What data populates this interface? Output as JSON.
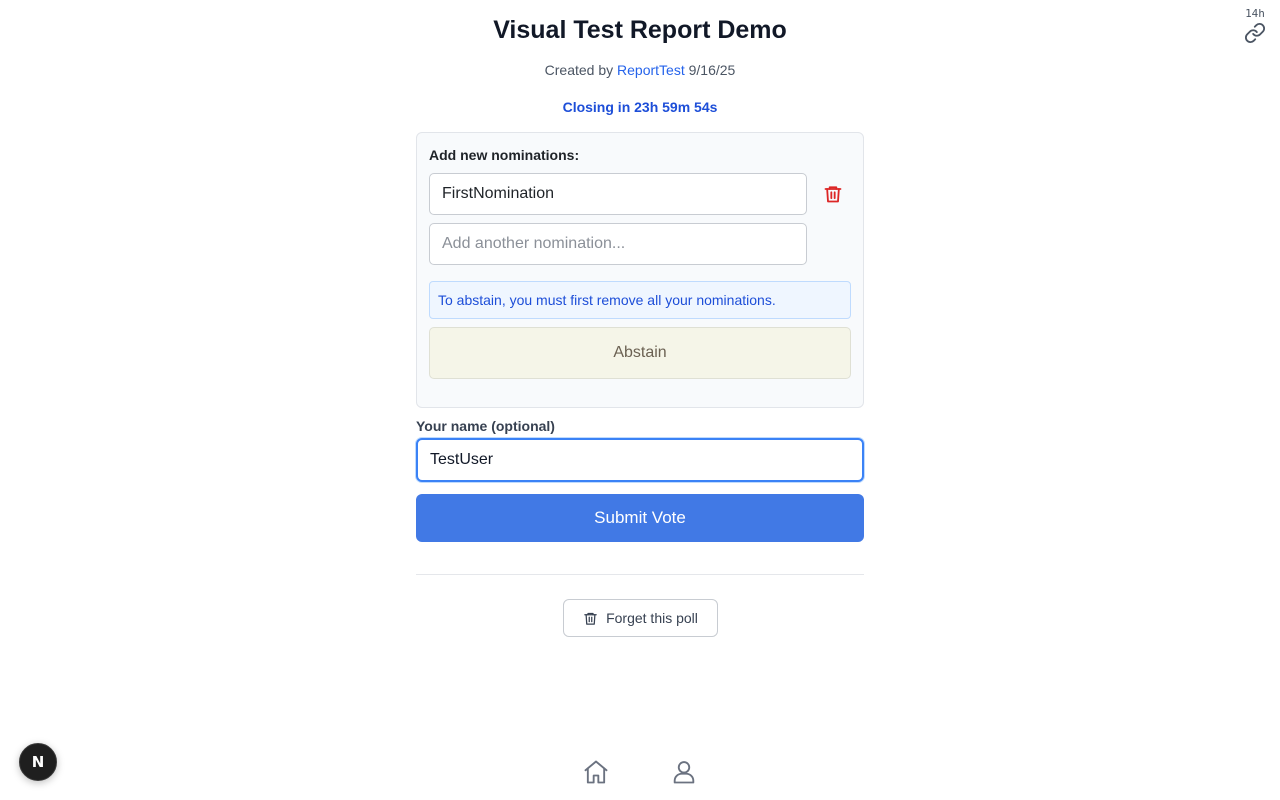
{
  "top_right": {
    "age": "14h",
    "link_icon": "link-icon"
  },
  "header": {
    "title": "Visual Test Report Demo",
    "created_by_prefix": "Created by",
    "creator": "ReportTest",
    "date": "9/16/25",
    "countdown": "Closing in 23h 59m 54s"
  },
  "nominations": {
    "heading": "Add new nominations:",
    "items": [
      {
        "value": "FirstNomination"
      }
    ],
    "new_placeholder": "Add another nomination...",
    "delete_icon": "trash-icon",
    "info_text": "To abstain, you must first remove all your nominations.",
    "abstain_label": "Abstain"
  },
  "voter": {
    "label": "Your name (optional)",
    "value": "TestUser"
  },
  "submit_label": "Submit Vote",
  "forget_label": "Forget this poll",
  "dev_badge_letter": "N",
  "bottom_nav": {
    "home_icon": "home-icon",
    "profile_icon": "user-icon"
  },
  "colors": {
    "accent": "#4179e5",
    "link": "#2563eb",
    "countdown": "#1d4ed8",
    "delete": "#dc2626",
    "abstain_bg": "#f5f5e8",
    "info_bg": "#eff6ff"
  }
}
